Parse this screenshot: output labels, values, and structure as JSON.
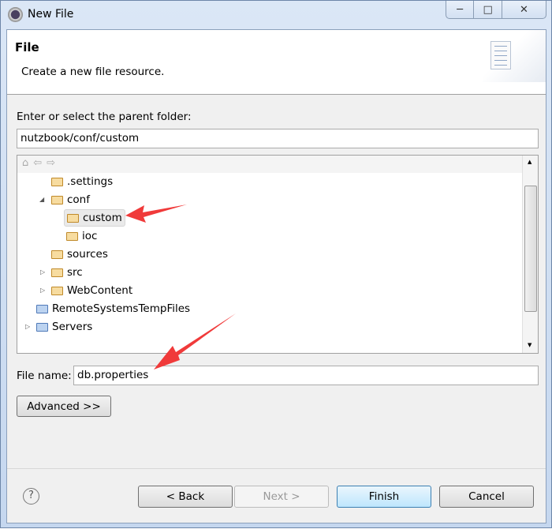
{
  "window": {
    "title": "New File",
    "controls": [
      "minimize",
      "maximize",
      "close"
    ]
  },
  "header": {
    "title": "File",
    "description": "Create a new file resource."
  },
  "parent_folder": {
    "label": "Enter or select the parent folder:",
    "value": "nutzbook/conf/custom"
  },
  "tree": {
    "toolbar_icons": [
      "home-icon",
      "back-arrow-icon",
      "forward-arrow-icon"
    ],
    "nodes": [
      {
        "label": ".settings"
      },
      {
        "label": "conf",
        "expanded": true
      },
      {
        "label": "custom",
        "selected": true
      },
      {
        "label": "ioc"
      },
      {
        "label": "sources"
      },
      {
        "label": "src",
        "collapsed": true
      },
      {
        "label": "WebContent",
        "collapsed": true
      },
      {
        "label": "RemoteSystemsTempFiles"
      },
      {
        "label": "Servers",
        "collapsed": true
      }
    ]
  },
  "file_name": {
    "label": "File name:",
    "value": "db.properties"
  },
  "buttons": {
    "advanced": "Advanced >>",
    "back": "< Back",
    "next": "Next >",
    "finish": "Finish",
    "cancel": "Cancel"
  },
  "annotation_color": "#f03a3a"
}
